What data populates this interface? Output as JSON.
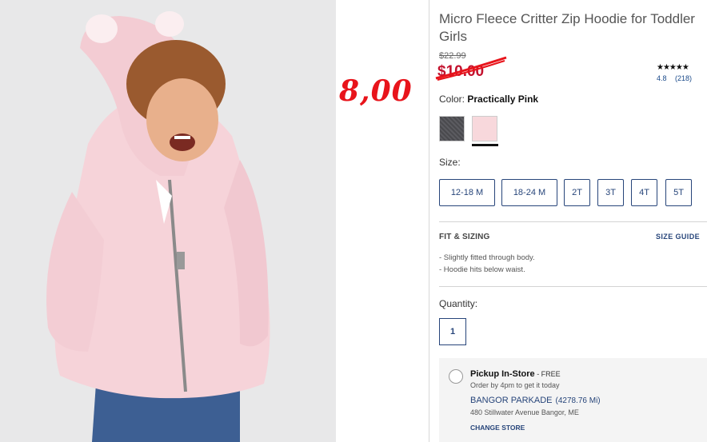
{
  "product": {
    "title": "Micro Fleece Critter Zip Hoodie for Toddler Girls",
    "original_price": "$22.99",
    "sale_price": "$10.00",
    "handwritten_price": "8,00",
    "stars": "★★★★★",
    "rating": "4.8",
    "review_count": "(218)"
  },
  "color": {
    "label": "Color:",
    "selected": "Practically Pink",
    "swatches": [
      "charcoal",
      "practically-pink"
    ]
  },
  "size": {
    "label": "Size:",
    "options": [
      "12-18 M",
      "18-24 M",
      "2T",
      "3T",
      "4T",
      "5T"
    ]
  },
  "fit": {
    "title": "FIT & SIZING",
    "size_guide": "SIZE GUIDE",
    "details": [
      "-  Slightly fitted through body.",
      "-  Hoodie hits below waist."
    ]
  },
  "quantity": {
    "label": "Quantity:",
    "value": "1"
  },
  "pickup": {
    "title": "Pickup In-Store",
    "free": " - FREE",
    "subtitle": "Order by 4pm to get it today",
    "store_name": "BANGOR PARKADE",
    "store_distance": "(4278.76 Mi)",
    "store_address": "480 Stillwater Avenue Bangor, ME",
    "change_store": "CHANGE STORE"
  },
  "colors": {
    "accent": "#27457a",
    "sale": "#c3122e",
    "handwriting": "#e8141b"
  }
}
